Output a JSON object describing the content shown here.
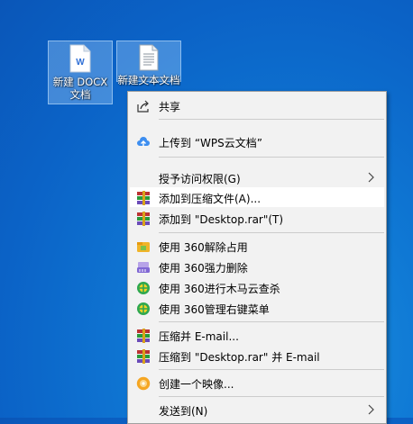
{
  "desktop": {
    "icons": [
      {
        "label_line1": "新建 DOCX",
        "label_line2": "文档",
        "icon": "wps-docx-icon"
      },
      {
        "label_line1": "新建文本文档",
        "icon": "text-file-icon"
      }
    ]
  },
  "context_menu": {
    "items": [
      {
        "label": "共享",
        "icon": "share-icon"
      },
      {
        "label": "上传到 “WPS云文档”",
        "icon": "cloud-upload-icon"
      },
      {
        "label": "授予访问权限(G)",
        "icon": "",
        "submenu": true
      },
      {
        "label": "添加到压缩文件(A)...",
        "icon": "winrar-icon",
        "highlighted": true
      },
      {
        "label": "添加到 \"Desktop.rar\"(T)",
        "icon": "winrar-icon"
      },
      {
        "label": "使用 360解除占用",
        "icon": "360-unlock-icon"
      },
      {
        "label": "使用 360强力删除",
        "icon": "360-shred-icon"
      },
      {
        "label": "使用 360进行木马云查杀",
        "icon": "360-scan-icon"
      },
      {
        "label": "使用 360管理右键菜单",
        "icon": "360-menu-icon"
      },
      {
        "label": "压缩并 E-mail...",
        "icon": "winrar-icon"
      },
      {
        "label": "压缩到 \"Desktop.rar\" 并 E-mail",
        "icon": "winrar-icon"
      },
      {
        "label": "创建一个映像...",
        "icon": "disc-image-icon"
      },
      {
        "label": "发送到(N)",
        "icon": "",
        "submenu": true
      }
    ]
  },
  "colors": {
    "desktop_bg": "#0f78d4",
    "menu_bg": "#f2f2f2",
    "highlight": "#ffffff"
  }
}
